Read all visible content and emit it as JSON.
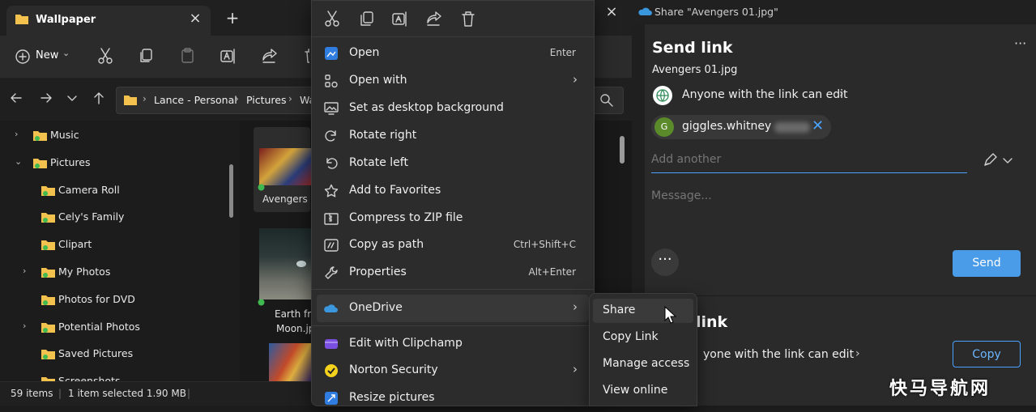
{
  "explorer": {
    "tab_title": "Wallpaper",
    "toolbar": {
      "new_label": "New",
      "new_caret": "⌄"
    },
    "address": {
      "crumbs": [
        "Lance - Personal",
        "Pictures",
        "Wa"
      ]
    },
    "nav_items": [
      {
        "label": "Music",
        "level": 0,
        "expand": "›"
      },
      {
        "label": "Pictures",
        "level": 0,
        "expand": "⌄"
      },
      {
        "label": "Camera Roll",
        "level": 1,
        "expand": ""
      },
      {
        "label": "Cely's Family",
        "level": 1,
        "expand": ""
      },
      {
        "label": "Clipart",
        "level": 1,
        "expand": ""
      },
      {
        "label": "My Photos",
        "level": 1,
        "expand": "›"
      },
      {
        "label": "Photos for DVD",
        "level": 1,
        "expand": ""
      },
      {
        "label": "Potential Photos",
        "level": 1,
        "expand": "›"
      },
      {
        "label": "Saved Pictures",
        "level": 1,
        "expand": ""
      },
      {
        "label": "Screenshots",
        "level": 1,
        "expand": ""
      }
    ],
    "files": [
      {
        "caption": "Avengers 0"
      },
      {
        "caption": "Earth fro",
        "caption2": "Moon.jp"
      },
      {
        "caption": ""
      }
    ],
    "status": {
      "items": "59 items",
      "selected": "1 item selected  1.90 MB"
    }
  },
  "context_menu": {
    "items": [
      {
        "label": "Open",
        "shortcut": "Enter",
        "arrow": "",
        "icon": "open-icon"
      },
      {
        "label": "Open with",
        "shortcut": "",
        "arrow": "›",
        "icon": "open-with-icon"
      },
      {
        "label": "Set as desktop background",
        "shortcut": "",
        "arrow": "",
        "icon": "desktop-background-icon"
      },
      {
        "label": "Rotate right",
        "shortcut": "",
        "arrow": "",
        "icon": "rotate-right-icon"
      },
      {
        "label": "Rotate left",
        "shortcut": "",
        "arrow": "",
        "icon": "rotate-left-icon"
      },
      {
        "label": "Add to Favorites",
        "shortcut": "",
        "arrow": "",
        "icon": "star-icon"
      },
      {
        "label": "Compress to ZIP file",
        "shortcut": "",
        "arrow": "",
        "icon": "zip-icon"
      },
      {
        "label": "Copy as path",
        "shortcut": "Ctrl+Shift+C",
        "arrow": "",
        "icon": "copy-path-icon"
      },
      {
        "label": "Properties",
        "shortcut": "Alt+Enter",
        "arrow": "",
        "icon": "wrench-icon"
      },
      {
        "label": "OneDrive",
        "shortcut": "",
        "arrow": "›",
        "icon": "onedrive-icon"
      },
      {
        "label": "Edit with Clipchamp",
        "shortcut": "",
        "arrow": "",
        "icon": "clipchamp-icon"
      },
      {
        "label": "Norton Security",
        "shortcut": "",
        "arrow": "›",
        "icon": "norton-icon"
      },
      {
        "label": "Resize pictures",
        "shortcut": "",
        "arrow": "",
        "icon": "resize-icon"
      }
    ]
  },
  "submenu": {
    "items": [
      "Share",
      "Copy Link",
      "Manage access",
      "View online"
    ]
  },
  "share": {
    "window_title": "Share \"Avengers 01.jpg\"",
    "heading": "Send link",
    "more": "···",
    "file_name": "Avengers 01.jpg",
    "permission": "Anyone with the link can edit",
    "permission_arrow": "›",
    "recipient": {
      "initial": "G",
      "name": "giggles.whitney"
    },
    "add_placeholder": "Add another",
    "message_placeholder": "Message...",
    "more_options": "···",
    "send_label": "Send",
    "copy_heading": "link",
    "copy_permission": "yone with the link can edit",
    "copy_label": "Copy"
  },
  "watermark": "快马导航网",
  "colors": {
    "accent": "#4a9be8",
    "folder": "#f2c14e",
    "sync_ok": "#3fb950",
    "avatar": "#5a8a2a"
  }
}
